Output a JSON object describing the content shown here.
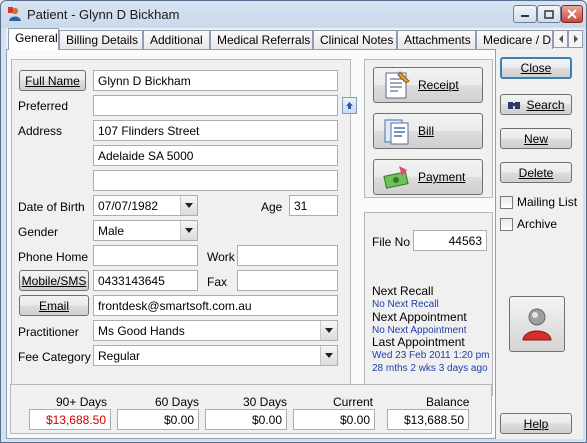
{
  "window": {
    "title": "Patient - Glynn D Bickham"
  },
  "tabs": [
    "General",
    "Billing Details",
    "Additional",
    "Medical Referrals",
    "Clinical Notes",
    "Attachments",
    "Medicare / D"
  ],
  "form": {
    "full_name_label": "Full Name",
    "full_name": "Glynn D Bickham",
    "preferred_label": "Preferred",
    "preferred": "",
    "address_label": "Address",
    "address1": "107 Flinders Street",
    "address2": "Adelaide SA 5000",
    "address3": "",
    "dob_label": "Date of Birth",
    "dob": "07/07/1982",
    "age_label": "Age",
    "age": "31",
    "gender_label": "Gender",
    "gender": "Male",
    "phone_home_label": "Phone Home",
    "phone_home": "",
    "work_label": "Work",
    "work": "",
    "mobile_label": "Mobile/SMS",
    "mobile": "0433143645",
    "fax_label": "Fax",
    "fax": "",
    "email_label": "Email",
    "email": "frontdesk@smartsoft.com.au",
    "practitioner_label": "Practitioner",
    "practitioner": "Ms Good Hands",
    "fee_category_label": "Fee Category",
    "fee_category": "Regular"
  },
  "actions": {
    "receipt": "Receipt",
    "bill": "Bill",
    "payment": "Payment"
  },
  "info": {
    "file_no_label": "File No",
    "file_no": "44563",
    "next_recall_label": "Next Recall",
    "next_recall": "No Next Recall",
    "next_appt_label": "Next Appointment",
    "next_appt": "No Next Appointment",
    "last_appt_label": "Last Appointment",
    "last_appt": "Wed 23 Feb 2011 1:20 pm",
    "last_appt_ago": "28 mths 2 wks 3 days ago"
  },
  "balances": {
    "d90_label": "90+ Days",
    "d90": "$13,688.50",
    "d60_label": "60 Days",
    "d60": "$0.00",
    "d30_label": "30 Days",
    "d30": "$0.00",
    "current_label": "Current",
    "current": "$0.00",
    "balance_label": "Balance",
    "balance": "$13,688.50"
  },
  "side": {
    "close": "Close",
    "search": "Search",
    "new": "New",
    "delete": "Delete",
    "mailing_list": "Mailing List",
    "archive": "Archive",
    "help": "Help"
  },
  "colors": {
    "overdue": "#d00000",
    "info_blue": "#1f3fa8"
  }
}
